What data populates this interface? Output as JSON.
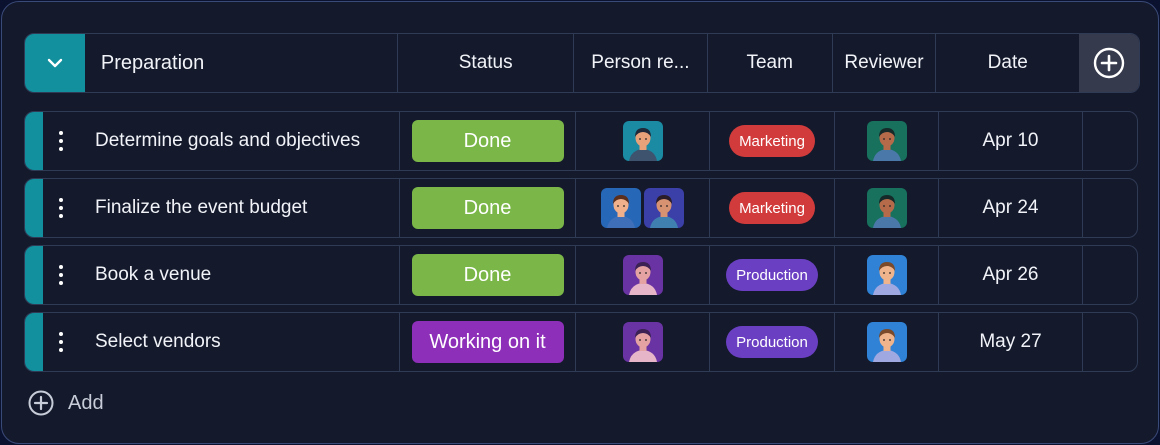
{
  "group": {
    "title": "Preparation",
    "accent_color": "#12909e",
    "columns": [
      "Status",
      "Person re...",
      "Team",
      "Reviewer",
      "Date"
    ],
    "add_column_icon": "plus-circle-icon",
    "collapse_icon": "chevron-down-icon"
  },
  "rows": [
    {
      "task": "Determine goals and objectives",
      "status": "Done",
      "status_color": "#7ab648",
      "people": [
        "avatar-man-teal"
      ],
      "team": "Marketing",
      "team_color": "#d23b3b",
      "reviewer": "avatar-man-green",
      "date": "Apr 10"
    },
    {
      "task": "Finalize the event budget",
      "status": "Done",
      "status_color": "#7ab648",
      "people": [
        "avatar-woman-blue",
        "avatar-woman-indigo"
      ],
      "team": "Marketing",
      "team_color": "#d23b3b",
      "reviewer": "avatar-man-green",
      "date": "Apr 24"
    },
    {
      "task": "Book a venue",
      "status": "Done",
      "status_color": "#7ab648",
      "people": [
        "avatar-woman-purple"
      ],
      "team": "Production",
      "team_color": "#6a3fc2",
      "reviewer": "avatar-man-blue",
      "date": "Apr 26"
    },
    {
      "task": "Select vendors",
      "status": "Working on it",
      "status_color": "#8d2fb8",
      "people": [
        "avatar-woman-purple"
      ],
      "team": "Production",
      "team_color": "#6a3fc2",
      "reviewer": "avatar-man-blue",
      "date": "May 27"
    }
  ],
  "add_label": "Add",
  "add_icon": "plus-circle-icon"
}
